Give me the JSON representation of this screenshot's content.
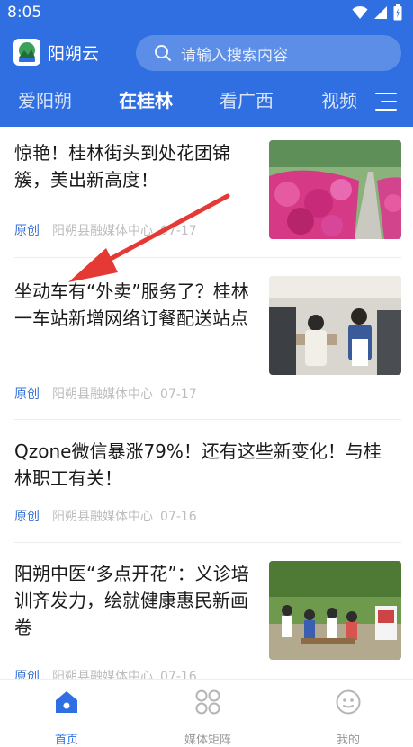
{
  "status": {
    "time": "8:05"
  },
  "app": {
    "name": "阳朔云"
  },
  "search": {
    "placeholder": "请输入搜索内容"
  },
  "tabs": [
    {
      "label": "爱阳朔",
      "active": false
    },
    {
      "label": "在桂林",
      "active": true
    },
    {
      "label": "看广西",
      "active": false
    },
    {
      "label": "视频",
      "active": false
    }
  ],
  "articles": [
    {
      "title": "惊艳！桂林街头到处花团锦簇，美出新高度！",
      "tag": "原创",
      "source": "阳朔县融媒体中心",
      "date": "07-17"
    },
    {
      "title": "坐动车有“外卖”服务了？桂林一车站新增网络订餐配送站点",
      "tag": "原创",
      "source": "阳朔县融媒体中心",
      "date": "07-17"
    },
    {
      "title": "Qzone微信暴涨79%！还有这些新变化！与桂林职工有关！",
      "tag": "原创",
      "source": "阳朔县融媒体中心",
      "date": "07-16"
    },
    {
      "title": "阳朔中医“多点开花”：义诊培训齐发力，绘就健康惠民新画卷",
      "tag": "原创",
      "source": "阳朔县融媒体中心",
      "date": "07-16"
    }
  ],
  "nav": [
    {
      "label": "首页",
      "icon": "home-icon",
      "active": true
    },
    {
      "label": "媒体矩阵",
      "icon": "grid-icon",
      "active": false
    },
    {
      "label": "我的",
      "icon": "profile-icon",
      "active": false
    }
  ],
  "colors": {
    "brand": "#2f6fe2",
    "tag": "#3a73d8",
    "meta": "#bdbdbd",
    "arrow": "#e53935"
  }
}
